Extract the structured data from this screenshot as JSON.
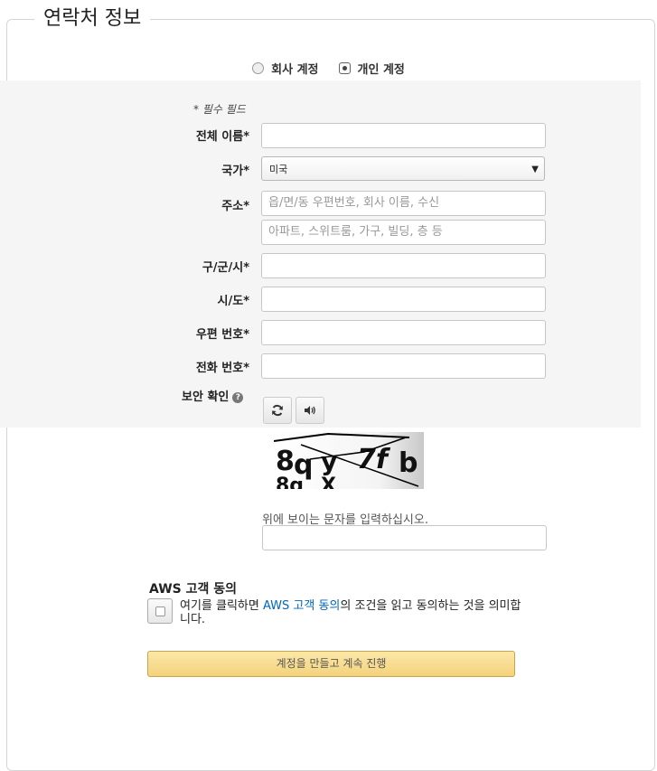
{
  "section": {
    "title": "연락처 정보"
  },
  "account_type": {
    "options": [
      {
        "label": "회사 계정",
        "checked": false
      },
      {
        "label": "개인 계정",
        "checked": true
      }
    ]
  },
  "form": {
    "required_note": "* 필수 필드",
    "full_name_label": "전체 이름*",
    "country_label": "국가*",
    "country_value": "미국",
    "address_label": "주소*",
    "address1_placeholder": "읍/면/동 우편번호, 회사 이름, 수신",
    "address2_placeholder": "아파트, 스위트룸, 가구, 빌딩, 층 등",
    "city_label": "구/군/시*",
    "state_label": "시/도*",
    "postal_label": "우편 번호*",
    "phone_label": "전화 번호*",
    "security_label": "보안 확인"
  },
  "captcha": {
    "hint": "위에 보이는 문자를 입력하십시오."
  },
  "agreement": {
    "title": "AWS 고객 동의",
    "text_before": "여기를 클릭하면 ",
    "link_text": "AWS 고객 동의",
    "text_after": "의 조건을 읽고 동의하는 것을 의미합니다."
  },
  "submit_label": "계정을 만들고 계속 진행",
  "icons": {
    "refresh": "refresh-icon",
    "audio": "speaker-icon",
    "help": "help-icon"
  }
}
